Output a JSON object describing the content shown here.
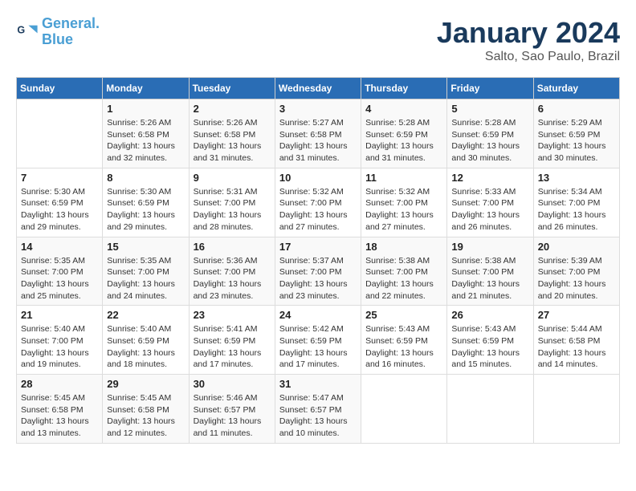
{
  "header": {
    "logo_line1": "General",
    "logo_line2": "Blue",
    "month": "January 2024",
    "location": "Salto, Sao Paulo, Brazil"
  },
  "weekdays": [
    "Sunday",
    "Monday",
    "Tuesday",
    "Wednesday",
    "Thursday",
    "Friday",
    "Saturday"
  ],
  "weeks": [
    [
      {
        "day": "",
        "info": ""
      },
      {
        "day": "1",
        "info": "Sunrise: 5:26 AM\nSunset: 6:58 PM\nDaylight: 13 hours\nand 32 minutes."
      },
      {
        "day": "2",
        "info": "Sunrise: 5:26 AM\nSunset: 6:58 PM\nDaylight: 13 hours\nand 31 minutes."
      },
      {
        "day": "3",
        "info": "Sunrise: 5:27 AM\nSunset: 6:58 PM\nDaylight: 13 hours\nand 31 minutes."
      },
      {
        "day": "4",
        "info": "Sunrise: 5:28 AM\nSunset: 6:59 PM\nDaylight: 13 hours\nand 31 minutes."
      },
      {
        "day": "5",
        "info": "Sunrise: 5:28 AM\nSunset: 6:59 PM\nDaylight: 13 hours\nand 30 minutes."
      },
      {
        "day": "6",
        "info": "Sunrise: 5:29 AM\nSunset: 6:59 PM\nDaylight: 13 hours\nand 30 minutes."
      }
    ],
    [
      {
        "day": "7",
        "info": "Sunrise: 5:30 AM\nSunset: 6:59 PM\nDaylight: 13 hours\nand 29 minutes."
      },
      {
        "day": "8",
        "info": "Sunrise: 5:30 AM\nSunset: 6:59 PM\nDaylight: 13 hours\nand 29 minutes."
      },
      {
        "day": "9",
        "info": "Sunrise: 5:31 AM\nSunset: 7:00 PM\nDaylight: 13 hours\nand 28 minutes."
      },
      {
        "day": "10",
        "info": "Sunrise: 5:32 AM\nSunset: 7:00 PM\nDaylight: 13 hours\nand 27 minutes."
      },
      {
        "day": "11",
        "info": "Sunrise: 5:32 AM\nSunset: 7:00 PM\nDaylight: 13 hours\nand 27 minutes."
      },
      {
        "day": "12",
        "info": "Sunrise: 5:33 AM\nSunset: 7:00 PM\nDaylight: 13 hours\nand 26 minutes."
      },
      {
        "day": "13",
        "info": "Sunrise: 5:34 AM\nSunset: 7:00 PM\nDaylight: 13 hours\nand 26 minutes."
      }
    ],
    [
      {
        "day": "14",
        "info": "Sunrise: 5:35 AM\nSunset: 7:00 PM\nDaylight: 13 hours\nand 25 minutes."
      },
      {
        "day": "15",
        "info": "Sunrise: 5:35 AM\nSunset: 7:00 PM\nDaylight: 13 hours\nand 24 minutes."
      },
      {
        "day": "16",
        "info": "Sunrise: 5:36 AM\nSunset: 7:00 PM\nDaylight: 13 hours\nand 23 minutes."
      },
      {
        "day": "17",
        "info": "Sunrise: 5:37 AM\nSunset: 7:00 PM\nDaylight: 13 hours\nand 23 minutes."
      },
      {
        "day": "18",
        "info": "Sunrise: 5:38 AM\nSunset: 7:00 PM\nDaylight: 13 hours\nand 22 minutes."
      },
      {
        "day": "19",
        "info": "Sunrise: 5:38 AM\nSunset: 7:00 PM\nDaylight: 13 hours\nand 21 minutes."
      },
      {
        "day": "20",
        "info": "Sunrise: 5:39 AM\nSunset: 7:00 PM\nDaylight: 13 hours\nand 20 minutes."
      }
    ],
    [
      {
        "day": "21",
        "info": "Sunrise: 5:40 AM\nSunset: 7:00 PM\nDaylight: 13 hours\nand 19 minutes."
      },
      {
        "day": "22",
        "info": "Sunrise: 5:40 AM\nSunset: 6:59 PM\nDaylight: 13 hours\nand 18 minutes."
      },
      {
        "day": "23",
        "info": "Sunrise: 5:41 AM\nSunset: 6:59 PM\nDaylight: 13 hours\nand 17 minutes."
      },
      {
        "day": "24",
        "info": "Sunrise: 5:42 AM\nSunset: 6:59 PM\nDaylight: 13 hours\nand 17 minutes."
      },
      {
        "day": "25",
        "info": "Sunrise: 5:43 AM\nSunset: 6:59 PM\nDaylight: 13 hours\nand 16 minutes."
      },
      {
        "day": "26",
        "info": "Sunrise: 5:43 AM\nSunset: 6:59 PM\nDaylight: 13 hours\nand 15 minutes."
      },
      {
        "day": "27",
        "info": "Sunrise: 5:44 AM\nSunset: 6:58 PM\nDaylight: 13 hours\nand 14 minutes."
      }
    ],
    [
      {
        "day": "28",
        "info": "Sunrise: 5:45 AM\nSunset: 6:58 PM\nDaylight: 13 hours\nand 13 minutes."
      },
      {
        "day": "29",
        "info": "Sunrise: 5:45 AM\nSunset: 6:58 PM\nDaylight: 13 hours\nand 12 minutes."
      },
      {
        "day": "30",
        "info": "Sunrise: 5:46 AM\nSunset: 6:57 PM\nDaylight: 13 hours\nand 11 minutes."
      },
      {
        "day": "31",
        "info": "Sunrise: 5:47 AM\nSunset: 6:57 PM\nDaylight: 13 hours\nand 10 minutes."
      },
      {
        "day": "",
        "info": ""
      },
      {
        "day": "",
        "info": ""
      },
      {
        "day": "",
        "info": ""
      }
    ]
  ]
}
